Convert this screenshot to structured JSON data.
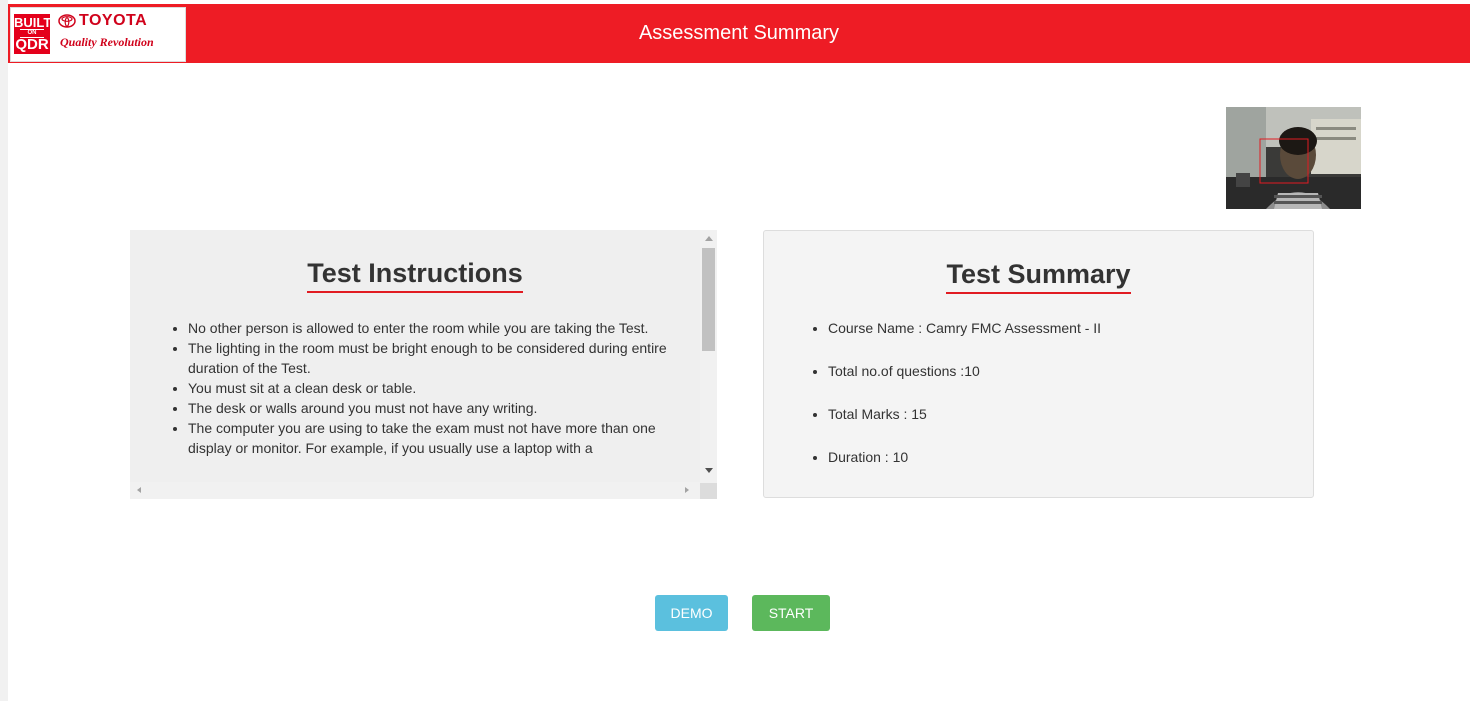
{
  "header": {
    "title": "Assessment Summary",
    "logo": {
      "badge_top": "BUILT",
      "badge_middle": "ON",
      "badge_bottom": "QDR",
      "brand": "TOYOTA",
      "tagline": "Quality Revolution"
    },
    "color": "#ee1c25"
  },
  "webcam": {
    "icon": "webcam-feed",
    "face_box_color": "#e11b22"
  },
  "instructions": {
    "title": "Test Instructions",
    "items": [
      "No other person is allowed to enter the room while you are taking the Test.",
      "The lighting in the room must be bright enough to be considered during entire duration of the Test.",
      "You must sit at a clean desk or table.",
      "The desk or walls around you must not have any writing.",
      "The computer you are using to take the exam must not have more than one display or monitor. For example, if you usually use a laptop with a"
    ]
  },
  "summary": {
    "title": "Test Summary",
    "items": [
      "Course Name : Camry FMC Assessment - II",
      "Total no.of questions :10",
      "Total Marks : 15",
      "Duration : 10"
    ]
  },
  "buttons": {
    "demo": "DEMO",
    "start": "START",
    "demo_color": "#5bc0de",
    "start_color": "#5cb85c"
  }
}
